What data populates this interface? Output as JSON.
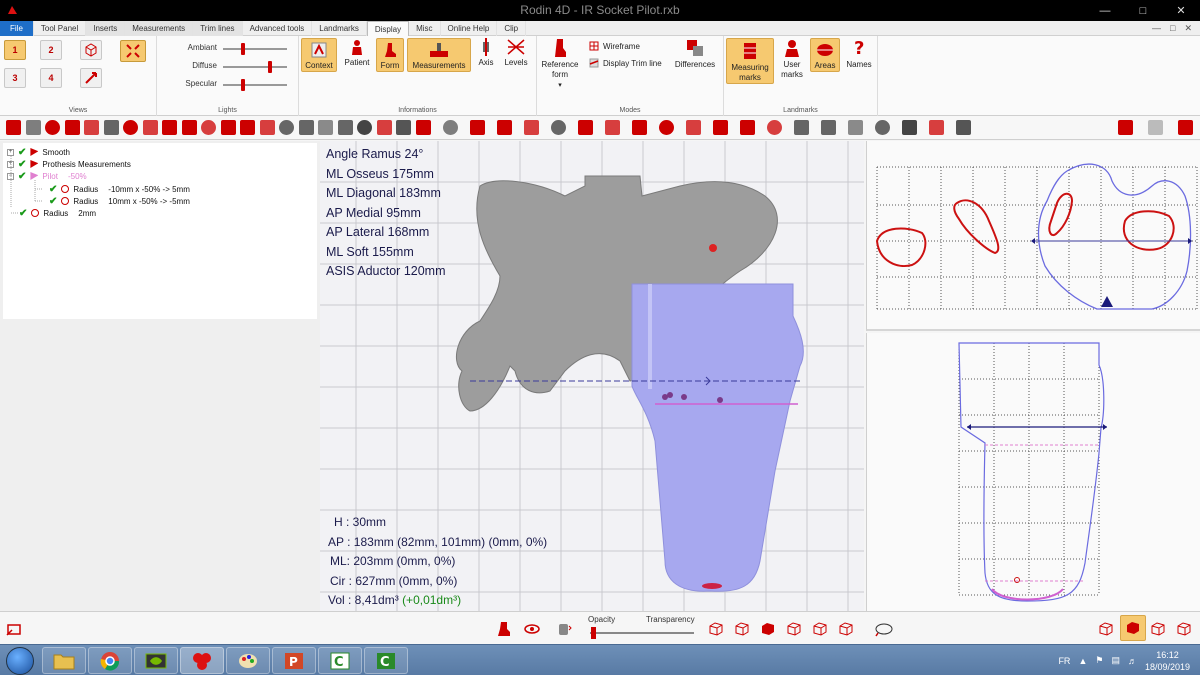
{
  "window": {
    "title": "Rodin 4D - IR Socket Pilot.rxb"
  },
  "menu": {
    "tabs": [
      "File",
      "Tool Panel",
      "Inserts",
      "Measurements",
      "Trim lines",
      "Advanced tools",
      "Landmarks",
      "Display",
      "Misc",
      "Online Help",
      "Clip"
    ],
    "active_tab": "Display"
  },
  "ribbon": {
    "groups": {
      "views": "Views",
      "lights": "Lights",
      "informations": "Informations",
      "modes": "Modes",
      "landmarks": "Landmarks"
    },
    "view_buttons": [
      "1",
      "2",
      "3",
      "4"
    ],
    "lights": [
      {
        "label": "Ambiant",
        "level": 0.3
      },
      {
        "label": "Diffuse",
        "level": 0.75
      },
      {
        "label": "Specular",
        "level": 0.3
      }
    ],
    "info_buttons": {
      "context": "Context",
      "patient": "Patient",
      "form": "Form",
      "measurements": "Measurements",
      "axis": "Axis",
      "levels": "Levels"
    },
    "modes": {
      "reference_form_l1": "Reference",
      "reference_form_l2": "form",
      "wireframe": "Wireframe",
      "display_trim_line": "Display Trim line",
      "differences": "Differences"
    },
    "landmarks": {
      "measuring_l1": "Measuring",
      "measuring_l2": "marks",
      "user_l1": "User",
      "user_l2": "marks",
      "areas": "Areas",
      "names": "Names"
    }
  },
  "tree": {
    "nodes": [
      {
        "label": "Smooth"
      },
      {
        "label": "Prothesis Measurements"
      },
      {
        "label": "Pilot",
        "value": "-50%"
      },
      {
        "label": "Radius",
        "value": "-10mm x -50% -> 5mm"
      },
      {
        "label": "Radius",
        "value": "10mm x -50% -> -5mm"
      },
      {
        "label": "Radius",
        "value": "2mm"
      }
    ]
  },
  "measurements": {
    "list": [
      "Angle Ramus 24°",
      "ML Osseus 175mm",
      "ML Diagonal 183mm",
      "AP Medial 95mm",
      "AP Lateral 168mm",
      "ML Soft 155mm",
      "ASIS Aductor 120mm"
    ],
    "section": {
      "h": "H : 30mm",
      "ap": "AP : 183mm (82mm, 101mm) (0mm, 0%)",
      "ml": "ML: 203mm (0mm, 0%)",
      "cir": "Cir : 627mm (0mm, 0%)",
      "vol": "Vol : 8,41dm³",
      "vol_delta": "(+0,01dm³)"
    }
  },
  "bottom": {
    "opacity": "Opacity",
    "transparency": "Transparency",
    "opacity_level": 0.02
  },
  "taskbar": {
    "lang": "FR",
    "time": "16:12",
    "date": "18/09/2019"
  },
  "colors": {
    "socket": "#a7a8ef",
    "bone": "#9d9d9d",
    "accent": "#f6c970",
    "outline_red": "#cc1111",
    "outline_blue": "#6b6be0"
  }
}
